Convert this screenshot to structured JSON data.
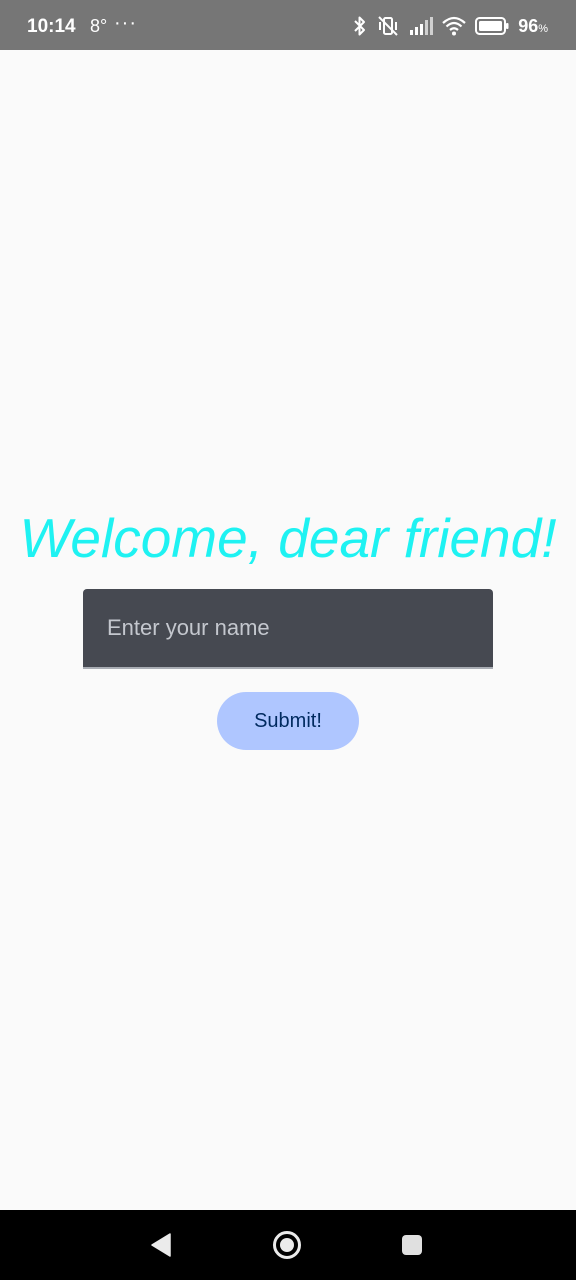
{
  "status_bar": {
    "time": "10:14",
    "temperature": "8°",
    "more": "···",
    "battery_percent": "96",
    "battery_unit": "%",
    "icons": [
      "bluetooth-icon",
      "vibrate-off-icon",
      "signal-icon",
      "wifi-icon",
      "battery-icon"
    ]
  },
  "main": {
    "welcome_text": "Welcome, dear friend!",
    "name_input": {
      "placeholder": "Enter your name",
      "value": ""
    },
    "submit_label": "Submit!"
  },
  "nav_bar": {
    "buttons": [
      "back-icon",
      "home-icon",
      "recents-icon"
    ]
  },
  "colors": {
    "welcome": "#1ef2f2",
    "input_bg": "#464951",
    "button_bg": "#afc6ff",
    "button_text": "#002a5f",
    "status_bar_bg": "#767676",
    "background": "#fafafa"
  }
}
